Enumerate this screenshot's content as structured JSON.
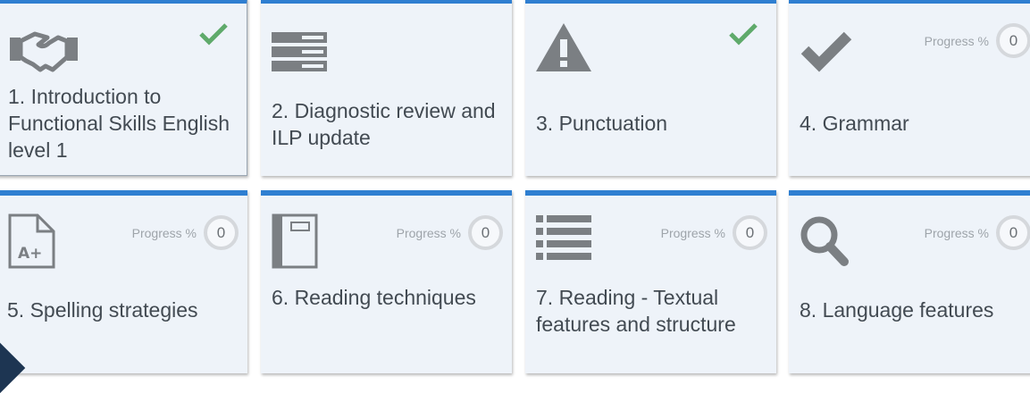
{
  "colors": {
    "accent": "#2f7fd1",
    "tile_bg": "#eef3f9",
    "icon": "#7b7f83",
    "check": "#5faa6b"
  },
  "tiles": [
    {
      "title": "1. Introduction to Functional Skills English level 1",
      "icon": "handshake-icon",
      "status": "complete"
    },
    {
      "title": "2. Diagnostic review and ILP update",
      "icon": "server-icon",
      "status": "none"
    },
    {
      "title": "3. Punctuation",
      "icon": "warning-icon",
      "status": "complete"
    },
    {
      "title": "4. Grammar",
      "icon": "check-icon",
      "status": "progress",
      "progress_label": "Progress %",
      "progress_value": "0"
    },
    {
      "title": "5. Spelling strategies",
      "icon": "grade-document-icon",
      "status": "progress",
      "progress_label": "Progress %",
      "progress_value": "0"
    },
    {
      "title": "6. Reading techniques",
      "icon": "book-icon",
      "status": "progress",
      "progress_label": "Progress %",
      "progress_value": "0"
    },
    {
      "title": "7. Reading - Textual features and structure",
      "icon": "list-icon",
      "status": "progress",
      "progress_label": "Progress %",
      "progress_value": "0"
    },
    {
      "title": "8. Language features",
      "icon": "search-icon",
      "status": "progress",
      "progress_label": "Progress %",
      "progress_value": "0"
    }
  ]
}
